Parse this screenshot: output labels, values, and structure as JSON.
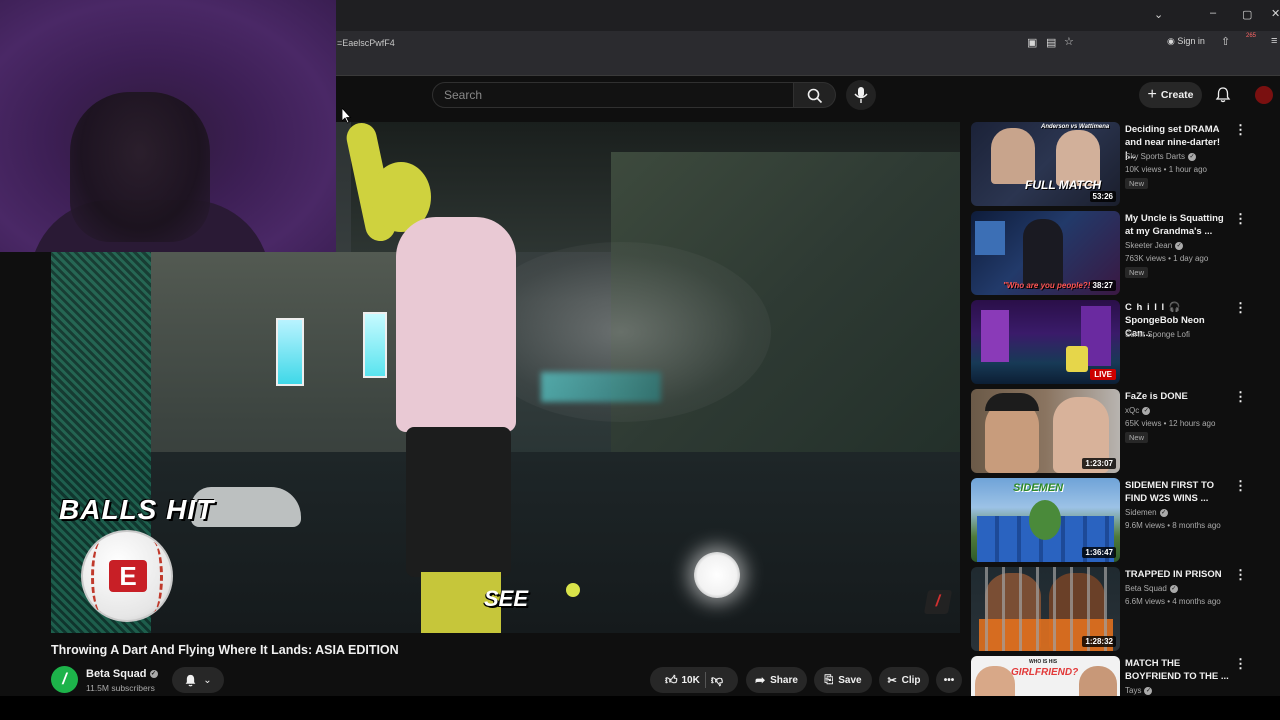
{
  "browser": {
    "url_fragment": "=EaelscPwfF4",
    "sign_in": "Sign in",
    "ext_badge": "265"
  },
  "masthead": {
    "search_placeholder": "Search",
    "create_label": "Create"
  },
  "player": {
    "overlay_text": "BALLS HIT",
    "caption": "SEE",
    "logo_letter": "E"
  },
  "video": {
    "title": "Throwing A Dart And Flying Where It Lands: ASIA EDITION",
    "channel": "Beta Squad",
    "subscribers": "11.5M subscribers",
    "likes": "10K",
    "share": "Share",
    "save": "Save",
    "clip": "Clip"
  },
  "recommendations": [
    {
      "title": "Deciding set DRAMA and near nine-darter! |...",
      "channel": "Sky Sports Darts",
      "meta": "10K views • 1 hour ago",
      "badge": "New",
      "duration": "53:26",
      "thumb_text": "FULL MATCH",
      "thumb_sub": "Anderson vs Wattimena"
    },
    {
      "title": "My Uncle is Squatting at my Grandma's ...",
      "channel": "Skeeter Jean",
      "meta": "763K views • 1 day ago",
      "badge": "New",
      "duration": "38:27",
      "thumb_text": "\"Who are you people?!\""
    },
    {
      "title": "SpongeBob Neon Can...",
      "title_pre": "C h i l l 🎧",
      "channel": "Sunlit Sponge Lofi",
      "meta": "",
      "badge": "",
      "live": "LIVE"
    },
    {
      "title": "FaZe is DONE",
      "channel": "xQc",
      "meta": "65K views • 12 hours ago",
      "badge": "New",
      "duration": "1:23:07"
    },
    {
      "title": "SIDEMEN FIRST TO FIND W2S WINS ...",
      "channel": "Sidemen",
      "meta": "9.6M views • 8 months ago",
      "badge": "",
      "duration": "1:36:47",
      "thumb_text": "SIDEMEN"
    },
    {
      "title": "TRAPPED IN PRISON",
      "channel": "Beta Squad",
      "meta": "6.6M views • 4 months ago",
      "badge": "",
      "duration": "1:28:32"
    },
    {
      "title": "MATCH THE BOYFRIEND TO THE ...",
      "channel": "Tays",
      "meta": "",
      "badge": "",
      "thumb_text": "GIRLFRIEND?",
      "thumb_sub": "WHO IS HIS"
    }
  ]
}
